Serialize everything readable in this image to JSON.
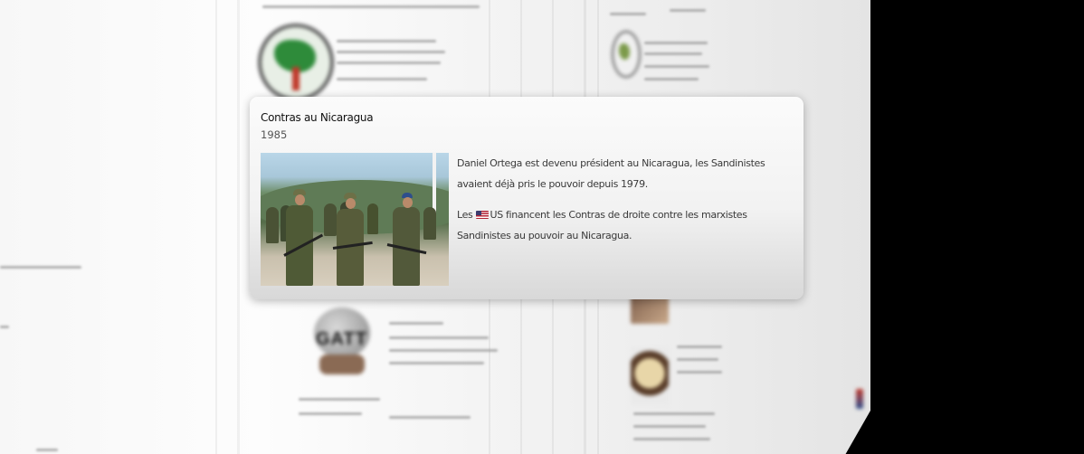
{
  "event": {
    "title": "Contras au Nicaragua",
    "year": "1985",
    "paragraph1": "Daniel Ortega est devenu président au Nicaragua, les Sandinistes avaient déjà pris le pouvoir depuis 1979.",
    "paragraph2_prefix": "Les ",
    "flag_icon": "us-flag-icon",
    "paragraph2_country": "US",
    "paragraph2_rest": "  financent les Contras de droite contre les marxistes Sandinistes au pouvoir au Nicaragua."
  },
  "background": {
    "emblem_badge": "GATT"
  }
}
